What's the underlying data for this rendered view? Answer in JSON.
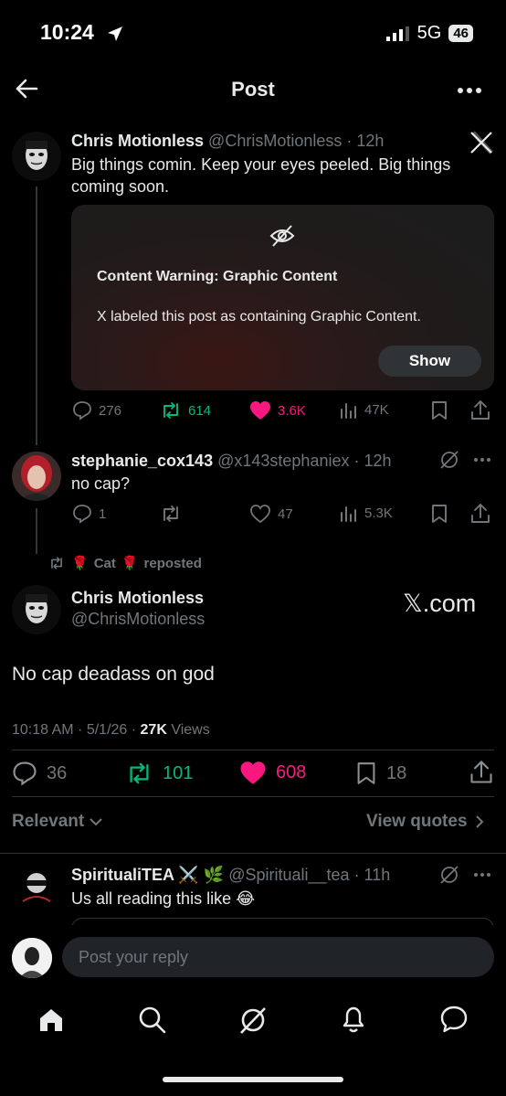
{
  "status_bar": {
    "time": "10:24",
    "network": "5G",
    "battery": "46"
  },
  "header": {
    "title": "Post"
  },
  "parent_post": {
    "name": "Chris Motionless",
    "handle": "@ChrisMotionless",
    "time": "· 12h",
    "text": "Big things comin. Keep your eyes peeled. Big things coming soon.",
    "content_warning": {
      "title": "Content Warning: Graphic Content",
      "body": "X labeled this post as containing Graphic Content.",
      "show_label": "Show"
    },
    "stats": {
      "replies": "276",
      "reposts": "614",
      "likes": "3.6K",
      "views": "47K"
    }
  },
  "reply_post": {
    "name": "stephanie_cox143",
    "handle": "@x143stephaniex",
    "time": "· 12h",
    "text": "no cap?",
    "stats": {
      "replies": "1",
      "reposts": "",
      "likes": "47",
      "views": "5.3K"
    }
  },
  "repost_banner": {
    "user": "Cat",
    "label": "reposted",
    "emoji": "🌹"
  },
  "main_post": {
    "name": "Chris Motionless",
    "handle": "@ChrisMotionless",
    "watermark": "𝕏.com",
    "text": "No cap deadass on god",
    "timestamp": "10:18 AM · 5/1/26 · ",
    "views_count": "27K",
    "views_label": " Views",
    "stats": {
      "replies": "36",
      "reposts": "101",
      "likes": "608",
      "bookmarks": "18"
    }
  },
  "sort": {
    "label": "Relevant",
    "view_quotes": "View quotes"
  },
  "third_reply": {
    "name": "SpiritualiTEA ⚔️ 🌿",
    "handle": "@Spirituali__tea",
    "time": "· 11h",
    "text": "Us all reading this like 😂"
  },
  "composer": {
    "placeholder": "Post your reply"
  },
  "colors": {
    "like": "#f91880",
    "repost": "#00ba7c",
    "muted": "#71767b",
    "background": "#000000"
  },
  "icons": [
    "back-arrow-icon",
    "more-icon",
    "x-logo-icon",
    "eye-off-icon",
    "reply-icon",
    "repost-icon",
    "heart-icon",
    "views-icon",
    "bookmark-icon",
    "share-icon",
    "grok-icon",
    "home-icon",
    "search-icon",
    "bell-icon",
    "messages-icon"
  ]
}
